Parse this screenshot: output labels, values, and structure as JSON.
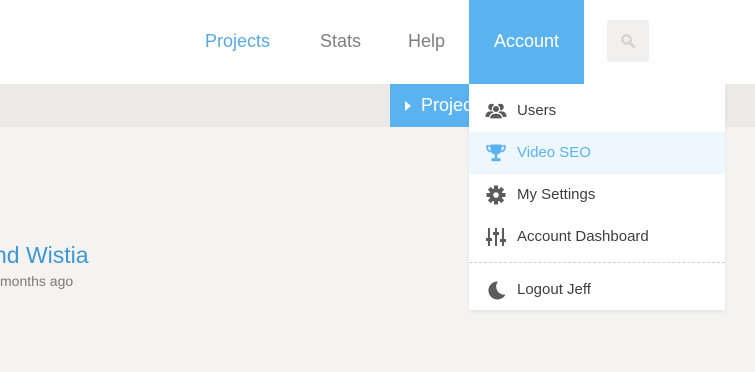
{
  "nav": {
    "projects": "Projects",
    "stats": "Stats",
    "help": "Help",
    "account": "Account",
    "search_icon": "search-icon"
  },
  "subnav": {
    "tab_label": "Projects"
  },
  "content": {
    "project_title": "nd Wistia",
    "project_meta": "months ago"
  },
  "account_menu": {
    "items": [
      {
        "label": "Users",
        "icon": "users-icon"
      },
      {
        "label": "Video SEO",
        "icon": "trophy-icon",
        "active": true
      },
      {
        "label": "My Settings",
        "icon": "gear-icon"
      },
      {
        "label": "Account Dashboard",
        "icon": "sliders-icon"
      },
      {
        "label": "Logout Jeff",
        "icon": "moon-icon"
      }
    ]
  },
  "colors": {
    "accent": "#5ab2ef",
    "link": "#3f98d4",
    "active_bg": "#eef7fd"
  }
}
